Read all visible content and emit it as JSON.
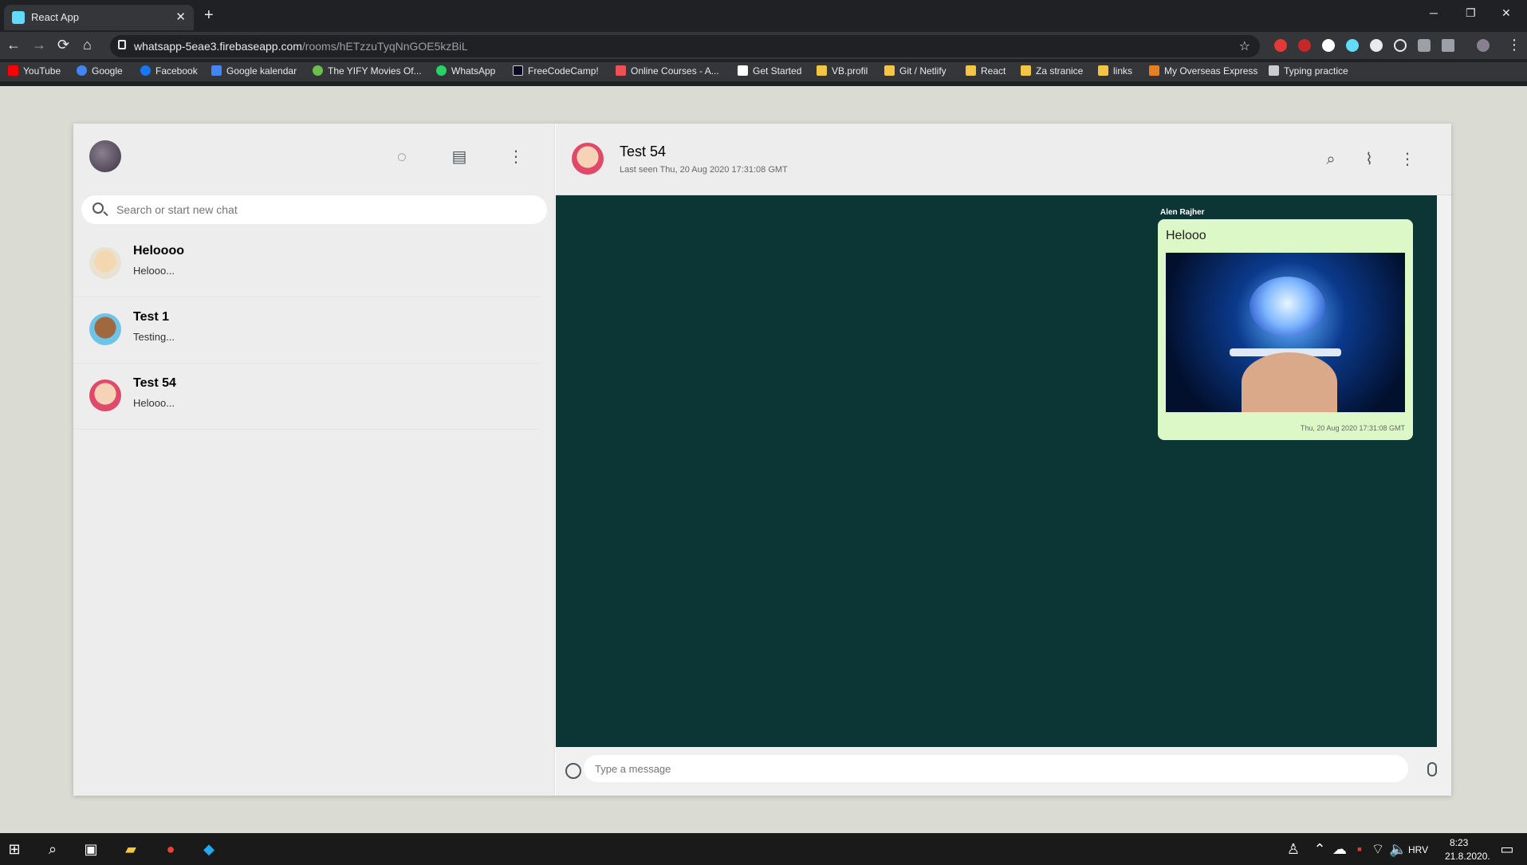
{
  "browser": {
    "tab_title": "React App",
    "url_host": "whatsapp-5eae3.firebaseapp.com",
    "url_path": "/rooms/hETzzuTyqNnGOE5kzBiL",
    "bookmarks": [
      "YouTube",
      "Google",
      "Facebook",
      "Google kalendar",
      "The YIFY Movies Of...",
      "WhatsApp",
      "FreeCodeCamp!",
      "Online Courses - A...",
      "Get Started",
      "VB.profil",
      "Git / Netlify",
      "React",
      "Za stranice",
      "links",
      "My Overseas Express",
      "Typing practice"
    ]
  },
  "sidebar": {
    "search_placeholder": "Search or start new chat",
    "chats": [
      {
        "name": "Heloooo",
        "last": "Helooo..."
      },
      {
        "name": "Test 1",
        "last": "Testing..."
      },
      {
        "name": "Test 54",
        "last": "Helooo..."
      }
    ]
  },
  "chat": {
    "title": "Test 54",
    "last_seen": "Last seen Thu, 20 Aug 2020 17:31:08 GMT",
    "message": {
      "sender": "Alen Rajher",
      "text": "Helooo",
      "time": "Thu, 20 Aug 2020 17:31:08 GMT"
    },
    "composer_placeholder": "Type a message"
  },
  "taskbar": {
    "lang": "HRV",
    "time": "8:23",
    "date": "21.8.2020."
  }
}
